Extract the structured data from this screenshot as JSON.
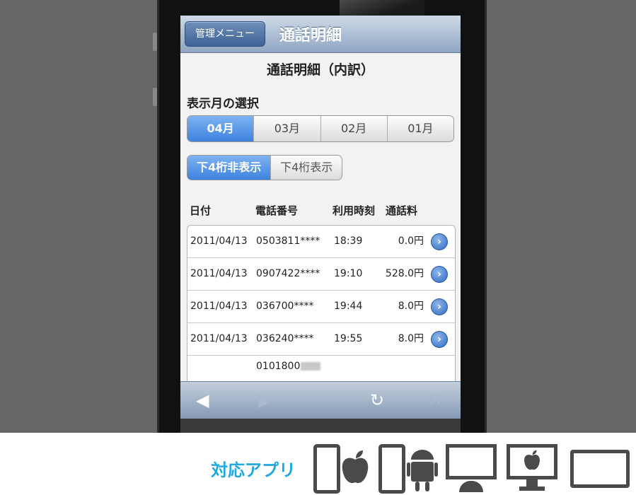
{
  "app": {
    "back_button": "管理メニュー",
    "title": "通話明細",
    "subtitle": "通話明細（内訳）"
  },
  "month_selector": {
    "label": "表示月の選択",
    "options": [
      "04月",
      "03月",
      "02月",
      "01月"
    ],
    "selected": "04月"
  },
  "mask_toggle": {
    "options": [
      "下4桁非表示",
      "下4桁表示"
    ],
    "selected": "下4桁非表示"
  },
  "table": {
    "headers": [
      "日付",
      "電話番号",
      "利用時刻",
      "通話料"
    ],
    "rows": [
      {
        "date": "2011/04/13",
        "number": "0503811****",
        "time": "18:39",
        "fee": "0.0円"
      },
      {
        "date": "2011/04/13",
        "number": "0907422****",
        "time": "19:10",
        "fee": "528.0円"
      },
      {
        "date": "2011/04/13",
        "number": "036700****",
        "time": "19:44",
        "fee": "8.0円"
      },
      {
        "date": "2011/04/13",
        "number": "036240****",
        "time": "19:55",
        "fee": "8.0円"
      },
      {
        "date": "",
        "number": "0101800",
        "time": "",
        "fee": ""
      }
    ]
  },
  "toolbar": {
    "icons": [
      "back-arrow-icon",
      "forward-arrow-icon",
      "reload-icon",
      "stop-icon"
    ]
  },
  "footer": {
    "label": "対応アプリ",
    "devices": [
      "iphone-apple-icon",
      "android-phone-icon",
      "windows-monitor-icon",
      "mac-monitor-icon",
      "tablet-icon"
    ]
  },
  "colors": {
    "accent_blue": "#3c83de",
    "footer_label": "#22a9e0"
  }
}
